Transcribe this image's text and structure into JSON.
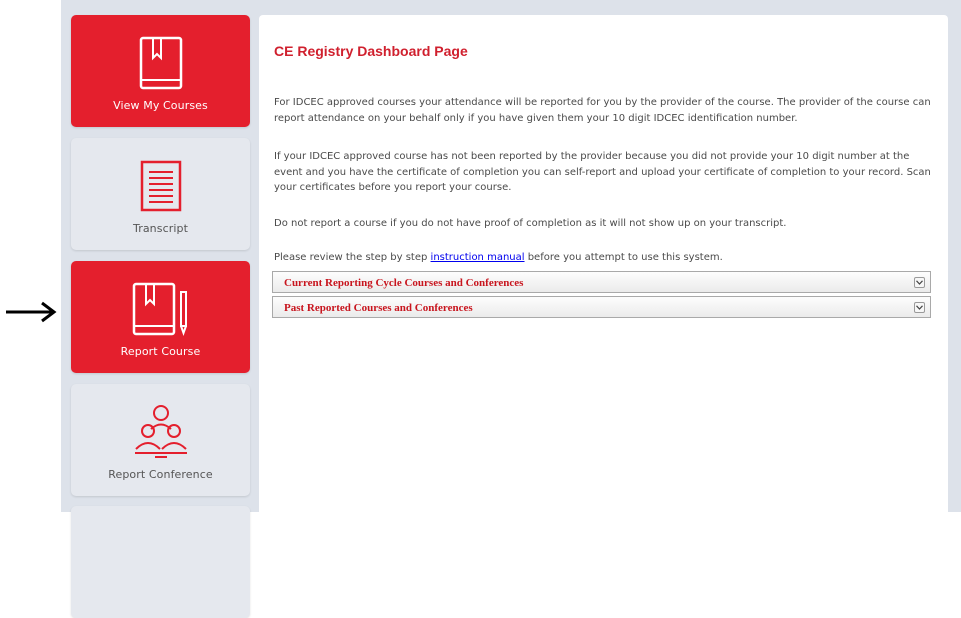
{
  "colors": {
    "accent": "#e41f2d",
    "title": "#d0202e",
    "tile_grey": "#e5e8ee",
    "background": "#dde2ea",
    "link": "#0000ee"
  },
  "sidebar": {
    "tiles": [
      {
        "label": "View My Courses",
        "icon": "book-icon",
        "style": "red"
      },
      {
        "label": "Transcript",
        "icon": "document-icon",
        "style": "grey"
      },
      {
        "label": "Report Course",
        "icon": "book-pencil-icon",
        "style": "red"
      },
      {
        "label": "Report Conference",
        "icon": "people-group-icon",
        "style": "grey"
      }
    ]
  },
  "main": {
    "title": "CE Registry Dashboard Page",
    "paragraphs": [
      "For IDCEC approved courses your attendance will be reported for you by the provider of the course. The provider of the course can report attendance on your behalf only if you have given them your 10 digit IDCEC identification number.",
      "If your IDCEC approved course has not been reported by the provider because you did not provide your 10 digit number at the event and you have the certificate of completion you can self-report and upload your certificate of completion to your record. Scan your certificates before you report your course.",
      "Do not report a course if you do not have proof of completion as it will not show up on your transcript."
    ],
    "review": {
      "before": "Please review the step by step ",
      "link": "instruction manual",
      "after": " before you attempt to use this system."
    },
    "accordions": [
      {
        "title": "Current Reporting Cycle Courses and Conferences"
      },
      {
        "title": "Past Reported Courses and Conferences"
      }
    ]
  },
  "annotation": {
    "icon": "right-arrow-icon"
  }
}
